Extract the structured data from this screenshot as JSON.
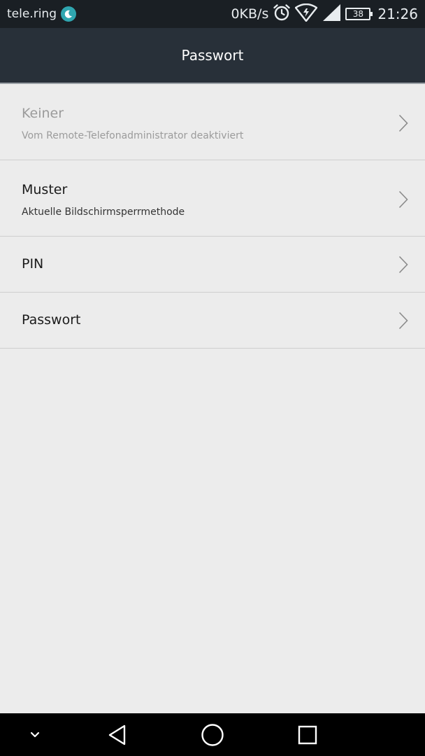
{
  "status_bar": {
    "carrier": "tele.ring",
    "net_speed": "0KB/s",
    "battery": "38",
    "time": "21:26",
    "icons": [
      "moon-icon",
      "alarm-icon",
      "wifi-icon",
      "signal-icon",
      "battery-icon"
    ]
  },
  "header": {
    "title": "Passwort"
  },
  "list": {
    "items": [
      {
        "label": "Keiner",
        "subtitle": "Vom Remote-Telefonadministrator deaktiviert",
        "disabled": true
      },
      {
        "label": "Muster",
        "subtitle": "Aktuelle Bildschirmsperrmethode",
        "disabled": false
      },
      {
        "label": "PIN",
        "disabled": false
      },
      {
        "label": "Passwort",
        "disabled": false
      }
    ]
  },
  "nav_bar": {
    "buttons": [
      "hide-keyboard-icon",
      "back-icon",
      "home-icon",
      "recents-icon"
    ]
  },
  "colors": {
    "status_bar_bg": "#1a1f24",
    "title_bar_bg": "#283039",
    "list_bg": "#ececec",
    "disabled_text": "#9b9b9b",
    "moon_badge": "#2fa6b0"
  }
}
